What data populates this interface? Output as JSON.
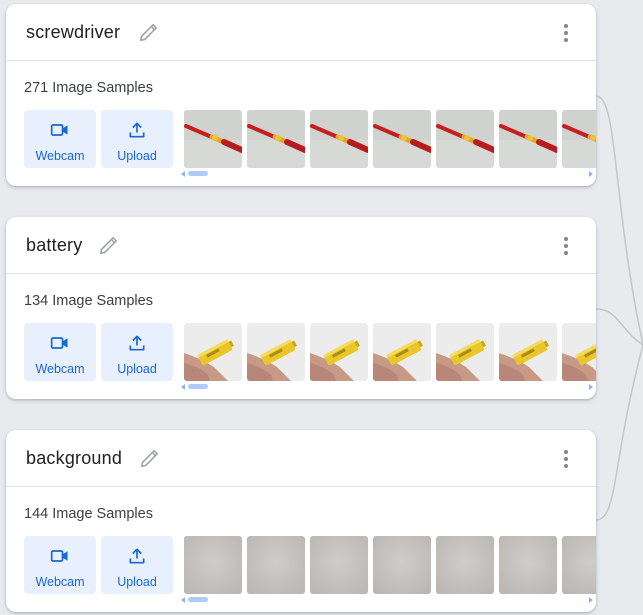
{
  "classes": [
    {
      "name": "screwdriver",
      "samples_label": "271 Image Samples",
      "thumbnail_kind": "screwdriver",
      "thumbnail_count": 7
    },
    {
      "name": "battery",
      "samples_label": "134 Image Samples",
      "thumbnail_kind": "battery",
      "thumbnail_count": 7
    },
    {
      "name": "background",
      "samples_label": "144 Image Samples",
      "thumbnail_kind": "background",
      "thumbnail_count": 7
    }
  ],
  "buttons": {
    "webcam_label": "Webcam",
    "upload_label": "Upload"
  },
  "icons": {
    "edit": "pencil-icon",
    "menu": "more-vert-icon",
    "webcam": "videocam-icon",
    "upload": "upload-icon"
  },
  "colors": {
    "page_background": "#e8eaed",
    "card_background": "#ffffff",
    "button_background": "#e8f0fe",
    "accent_blue": "#1967d2",
    "title_text": "#202124",
    "muted_icon": "#9aa0a6"
  }
}
